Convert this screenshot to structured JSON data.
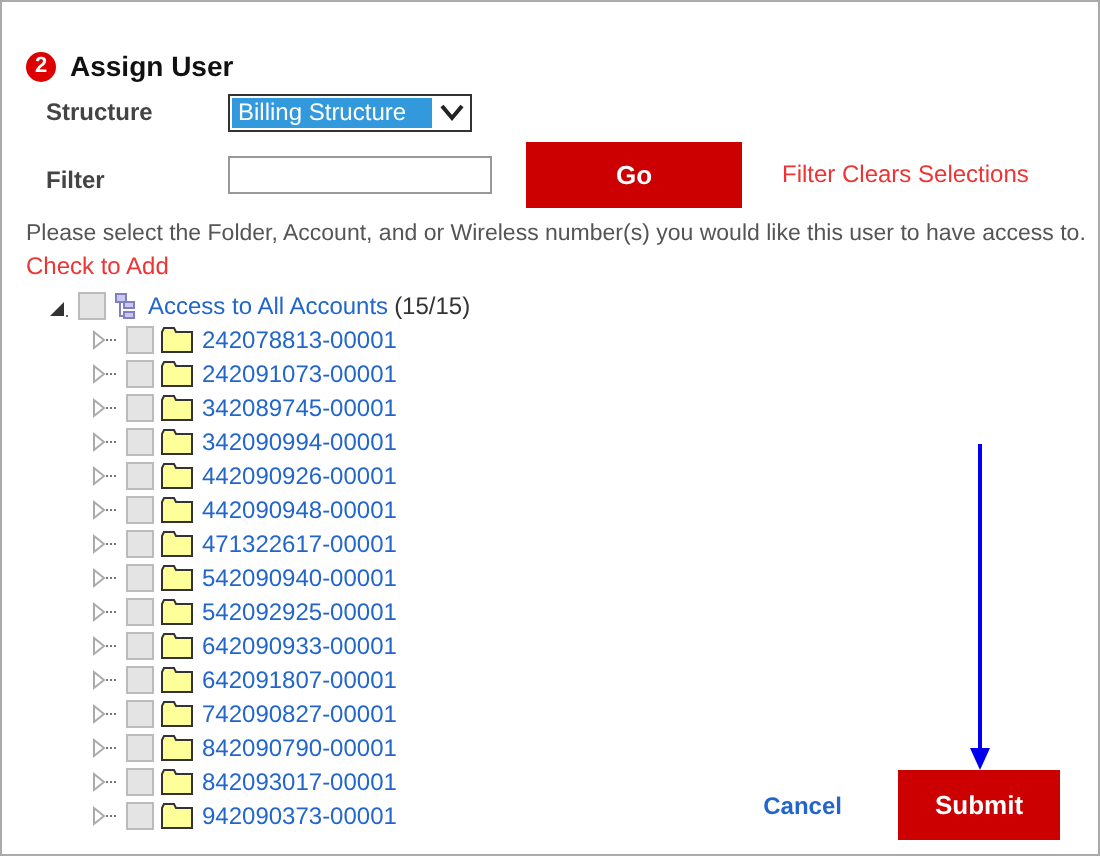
{
  "section": {
    "step": "2",
    "title": "Assign User"
  },
  "structure": {
    "label": "Structure",
    "value": "Billing Structure"
  },
  "filter": {
    "label": "Filter",
    "button": "Go",
    "note": "Filter Clears Selections"
  },
  "instructions": "Please select the Folder, Account, and or Wireless number(s) you would like this user to have access to.",
  "check_to_add": "Check to Add",
  "tree": {
    "label": "Access to All Accounts",
    "count": "(15/15)",
    "checked": false,
    "expanded": true,
    "children": [
      {
        "label": "242078813-00001",
        "checked": false
      },
      {
        "label": "242091073-00001",
        "checked": false
      },
      {
        "label": "342089745-00001",
        "checked": false
      },
      {
        "label": "342090994-00001",
        "checked": false
      },
      {
        "label": "442090926-00001",
        "checked": false
      },
      {
        "label": "442090948-00001",
        "checked": false
      },
      {
        "label": "471322617-00001",
        "checked": false
      },
      {
        "label": "542090940-00001",
        "checked": false
      },
      {
        "label": "542092925-00001",
        "checked": false
      },
      {
        "label": "642090933-00001",
        "checked": false
      },
      {
        "label": "642091807-00001",
        "checked": false
      },
      {
        "label": "742090827-00001",
        "checked": false
      },
      {
        "label": "842090790-00001",
        "checked": false
      },
      {
        "label": "842093017-00001",
        "checked": false
      },
      {
        "label": "942090373-00001",
        "checked": false
      }
    ]
  },
  "actions": {
    "cancel": "Cancel",
    "submit": "Submit"
  }
}
